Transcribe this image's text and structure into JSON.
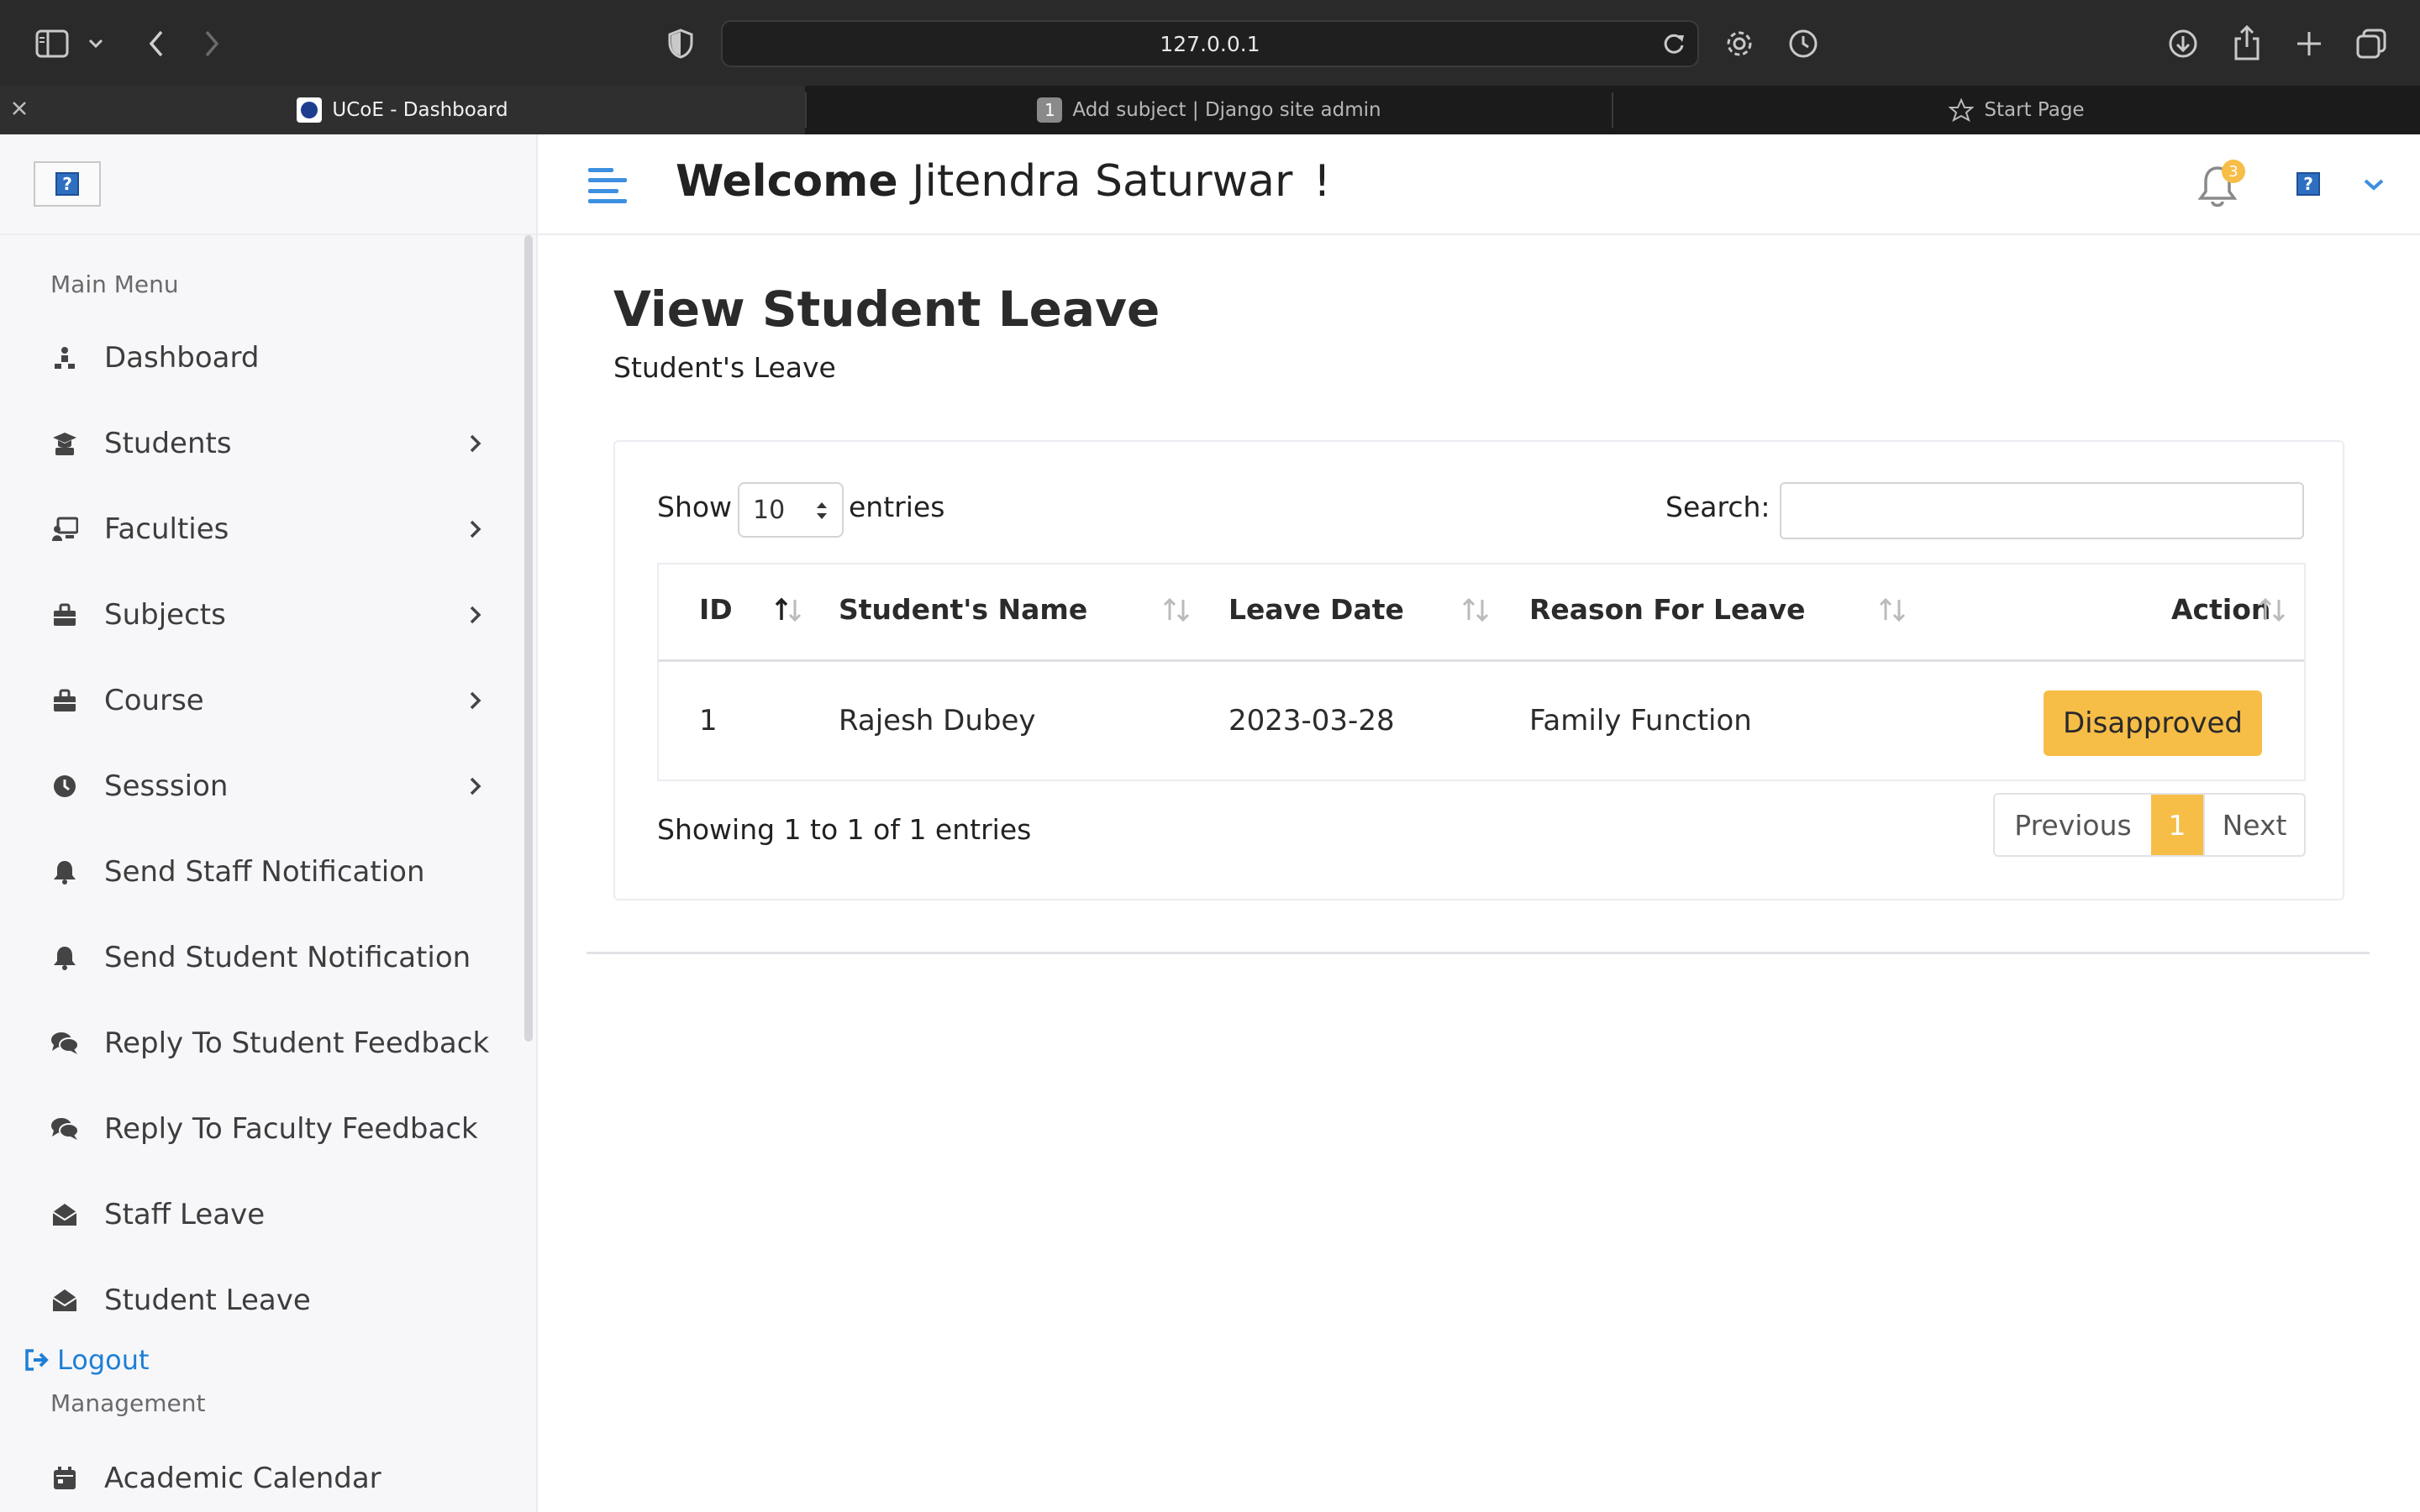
{
  "browser": {
    "url": "127.0.0.1",
    "tabs": [
      {
        "title": "UCoE - Dashboard",
        "active": true
      },
      {
        "title": "Add subject | Django site admin",
        "badge": "1",
        "active": false
      },
      {
        "title": "Start Page",
        "active": false
      }
    ]
  },
  "sidebar": {
    "main_menu_title": "Main Menu",
    "items": [
      {
        "label": "Dashboard",
        "icon": "dashboard-icon",
        "has_submenu": false
      },
      {
        "label": "Students",
        "icon": "student-icon",
        "has_submenu": true
      },
      {
        "label": "Faculties",
        "icon": "faculty-icon",
        "has_submenu": true
      },
      {
        "label": "Subjects",
        "icon": "subjects-icon",
        "has_submenu": true
      },
      {
        "label": "Course",
        "icon": "course-icon",
        "has_submenu": true
      },
      {
        "label": "Sesssion",
        "icon": "clock-icon",
        "has_submenu": true
      },
      {
        "label": "Send Staff Notification",
        "icon": "bell-icon",
        "has_submenu": false
      },
      {
        "label": "Send Student Notification",
        "icon": "bell-icon",
        "has_submenu": false
      },
      {
        "label": "Reply To Student Feedback",
        "icon": "comments-icon",
        "has_submenu": false
      },
      {
        "label": "Reply To Faculty Feedback",
        "icon": "comments-icon",
        "has_submenu": false
      },
      {
        "label": "Staff Leave",
        "icon": "envelope-open-icon",
        "has_submenu": false
      },
      {
        "label": "Student Leave",
        "icon": "envelope-open-icon",
        "has_submenu": false
      }
    ],
    "logout_label": "Logout",
    "management_title": "Management",
    "management_items": [
      {
        "label": "Academic Calendar",
        "icon": "calendar-icon"
      }
    ]
  },
  "header": {
    "welcome_prefix": "Welcome",
    "user_name": "Jitendra Saturwar",
    "exclaim": "!",
    "notification_count": "3"
  },
  "page": {
    "title": "View Student Leave",
    "subtitle": "Student's Leave"
  },
  "table_controls": {
    "show_label": "Show",
    "entries_label": "entries",
    "page_length": "10",
    "search_label": "Search:",
    "search_value": ""
  },
  "table": {
    "columns": [
      "ID",
      "Student's Name",
      "Leave Date",
      "Reason For Leave",
      "Action"
    ],
    "rows": [
      {
        "id": "1",
        "name": "Rajesh Dubey",
        "date": "2023-03-28",
        "reason": "Family Function",
        "action": "Disapproved"
      }
    ]
  },
  "footer_info": "Showing 1 to 1 of 1 entries",
  "pagination": {
    "previous": "Previous",
    "current": "1",
    "next": "Next"
  },
  "colors": {
    "accent": "#f6bd47",
    "link": "#1e7fd6",
    "menu_toggle": "#3d8fe0"
  }
}
